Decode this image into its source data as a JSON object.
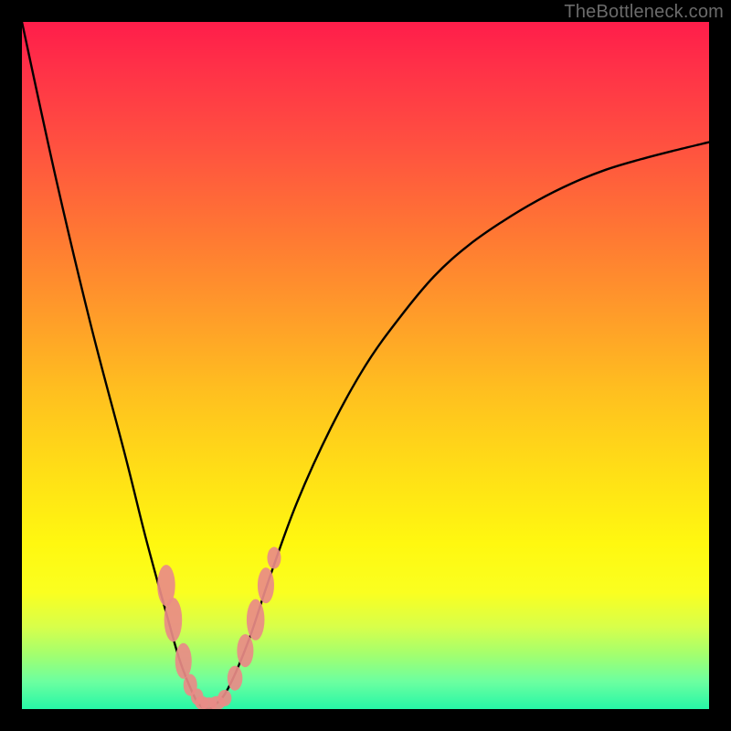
{
  "watermark": "TheBottleneck.com",
  "chart_data": {
    "type": "line",
    "title": "",
    "xlabel": "",
    "ylabel": "",
    "xlim": [
      0,
      100
    ],
    "ylim": [
      0,
      100
    ],
    "series": [
      {
        "name": "bottleneck-curve",
        "x": [
          0,
          5,
          10,
          15,
          18,
          21,
          23,
          25,
          26,
          27,
          28,
          30,
          33,
          36,
          40,
          45,
          50,
          55,
          60,
          65,
          70,
          75,
          80,
          85,
          90,
          95,
          100
        ],
        "values": [
          100,
          77,
          56,
          37,
          25,
          14,
          7,
          2,
          0.5,
          0,
          0.5,
          3,
          10,
          19,
          30,
          41,
          50,
          57,
          63,
          67.5,
          71,
          74,
          76.5,
          78.5,
          80,
          81.3,
          82.5
        ]
      }
    ],
    "markers": [
      {
        "name": "left-cluster-high",
        "x": 21.0,
        "y_pct": 18,
        "rx": 1.3,
        "ry": 3.0
      },
      {
        "name": "left-cluster-mid-a",
        "x": 22.0,
        "y_pct": 13,
        "rx": 1.3,
        "ry": 3.2
      },
      {
        "name": "left-cluster-mid-b",
        "x": 23.5,
        "y_pct": 7,
        "rx": 1.2,
        "ry": 2.6
      },
      {
        "name": "left-cluster-low-a",
        "x": 24.5,
        "y_pct": 3.5,
        "rx": 1.0,
        "ry": 1.6
      },
      {
        "name": "left-cluster-low-b",
        "x": 25.5,
        "y_pct": 1.8,
        "rx": 0.9,
        "ry": 1.2
      },
      {
        "name": "bottom-a",
        "x": 26.2,
        "y_pct": 0.9,
        "rx": 1.0,
        "ry": 1.0
      },
      {
        "name": "bottom-b",
        "x": 27.2,
        "y_pct": 0.7,
        "rx": 1.2,
        "ry": 1.0
      },
      {
        "name": "bottom-c",
        "x": 28.4,
        "y_pct": 0.9,
        "rx": 1.2,
        "ry": 1.0
      },
      {
        "name": "bottom-d",
        "x": 29.5,
        "y_pct": 1.6,
        "rx": 1.0,
        "ry": 1.2
      },
      {
        "name": "right-cluster-low",
        "x": 31.0,
        "y_pct": 4.5,
        "rx": 1.1,
        "ry": 1.8
      },
      {
        "name": "right-cluster-mid-a",
        "x": 32.5,
        "y_pct": 8.5,
        "rx": 1.2,
        "ry": 2.4
      },
      {
        "name": "right-cluster-mid-b",
        "x": 34.0,
        "y_pct": 13,
        "rx": 1.3,
        "ry": 3.0
      },
      {
        "name": "right-cluster-high",
        "x": 35.5,
        "y_pct": 18,
        "rx": 1.2,
        "ry": 2.6
      },
      {
        "name": "right-cluster-top",
        "x": 36.7,
        "y_pct": 22,
        "rx": 1.0,
        "ry": 1.6
      }
    ],
    "gradient_stops": [
      {
        "pct": 0,
        "color": "#ff1d4a"
      },
      {
        "pct": 50,
        "color": "#ffc01f"
      },
      {
        "pct": 80,
        "color": "#fff810"
      },
      {
        "pct": 100,
        "color": "#26f7a6"
      }
    ]
  }
}
